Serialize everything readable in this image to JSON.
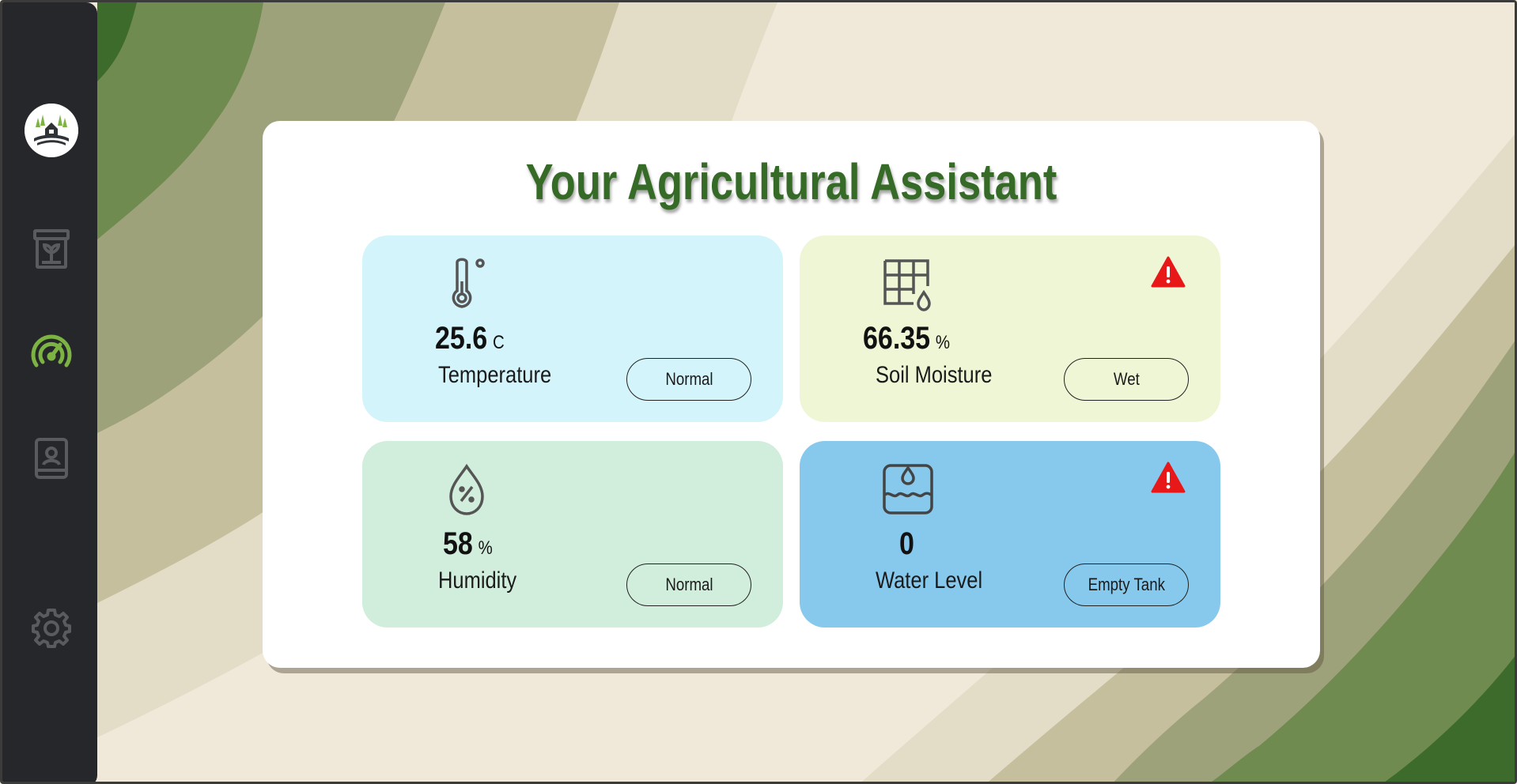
{
  "page": {
    "title": "Your Agricultural Assistant"
  },
  "sidebar": {
    "items": [
      {
        "icon": "seed-bag-icon",
        "active": false
      },
      {
        "icon": "dashboard-gauge-icon",
        "active": true
      },
      {
        "icon": "contact-book-icon",
        "active": false
      },
      {
        "icon": "gear-icon",
        "active": false
      }
    ],
    "logo_icon": "farm-logo-icon",
    "active_color": "#7cb342",
    "inactive_color": "#5a5b5e"
  },
  "metrics": {
    "temperature": {
      "value": "25.6",
      "unit": "C",
      "label": "Temperature",
      "status": "Normal",
      "alert": false,
      "bg": "#d4f4fb"
    },
    "soil_moisture": {
      "value": "66.35",
      "unit": "%",
      "label": "Soil Moisture",
      "status": "Wet",
      "alert": true,
      "bg": "#eff6d5"
    },
    "humidity": {
      "value": "58",
      "unit": "%",
      "label": "Humidity",
      "status": "Normal",
      "alert": false,
      "bg": "#d1eddc"
    },
    "water_level": {
      "value": "0",
      "unit": "",
      "label": "Water Level",
      "status": "Empty Tank",
      "alert": true,
      "bg": "#86c9ed"
    }
  },
  "colors": {
    "title": "#356a27",
    "alert": "#e81818",
    "sidebar_bg": "#26272a"
  }
}
